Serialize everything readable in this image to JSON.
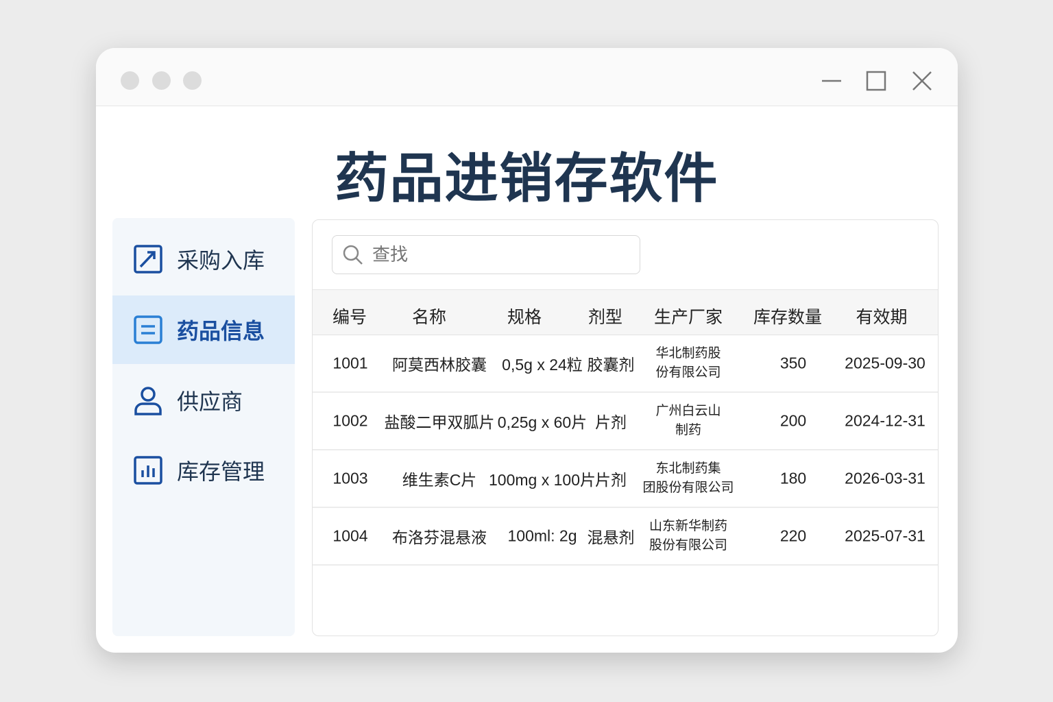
{
  "app": {
    "title": "药品进销存软件"
  },
  "sidebar": {
    "items": [
      {
        "label": "采购入库",
        "icon": "chart-arrow-icon"
      },
      {
        "label": "药品信息",
        "icon": "list-icon"
      },
      {
        "label": "供应商",
        "icon": "user-icon"
      },
      {
        "label": "库存管理",
        "icon": "bar-chart-icon"
      }
    ],
    "active": 1
  },
  "search": {
    "placeholder": "查找"
  },
  "table": {
    "headers": [
      "编号",
      "名称",
      "规格",
      "剂型",
      "生产厂家",
      "库存数量",
      "有效期"
    ],
    "rows": [
      {
        "id": "1001",
        "name": "阿莫西林胶囊",
        "spec": "0,5g x 24粒",
        "form": "胶囊剂",
        "maker1": "华北制药股",
        "maker2": "份有限公司",
        "qty": "350",
        "expiry": "2025-09-30"
      },
      {
        "id": "1002",
        "name": "盐酸二甲双胍片",
        "spec": "0,25g x 60片",
        "form": "片剂",
        "maker1": "广州白云山",
        "maker2": "制药",
        "qty": "200",
        "expiry": "2024-12-31"
      },
      {
        "id": "1003",
        "name": "维生素C片",
        "spec": "100mg x 100片",
        "form": "片剂",
        "maker1": "东北制药集",
        "maker2": "团股份有限公司",
        "qty": "180",
        "expiry": "2026-03-31"
      },
      {
        "id": "1004",
        "name": "布洛芬混悬液",
        "spec": "100ml: 2g",
        "form": "混悬剂",
        "maker1": "山东新华制药",
        "maker2": "股份有限公司",
        "qty": "220",
        "expiry": "2025-07-31"
      }
    ]
  },
  "colors": {
    "accent": "#1a4fa0",
    "title": "#1f3550",
    "active_bg": "#dcebfa"
  }
}
